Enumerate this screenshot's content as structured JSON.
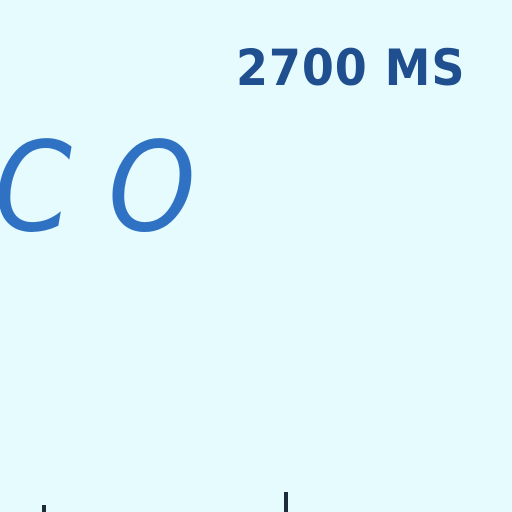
{
  "display": {
    "timer_text": "2700 MS",
    "letters": [
      "C",
      "O"
    ]
  },
  "colors": {
    "background": "#e6fbfd",
    "timer": "#1f4f8f",
    "letters": "#2f72c4",
    "ticks": "#1d2b3a"
  }
}
